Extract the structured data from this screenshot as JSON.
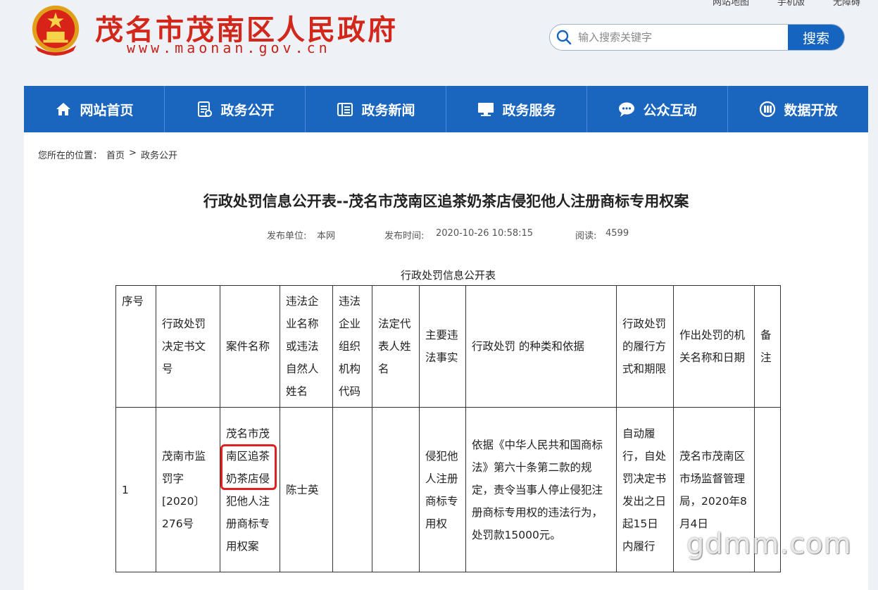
{
  "site": {
    "title": "茂名市茂南区人民政府",
    "domain": "www.maonan.gov.cn",
    "toplinks": [
      "网站地图",
      "手机版",
      "无障碍"
    ]
  },
  "search": {
    "placeholder": "输入搜索关键字",
    "button_label": "搜索"
  },
  "nav": {
    "items": [
      {
        "label": "网站首页",
        "icon": "home-icon"
      },
      {
        "label": "政务公开",
        "icon": "document-icon"
      },
      {
        "label": "政务新闻",
        "icon": "news-icon"
      },
      {
        "label": "政务服务",
        "icon": "monitor-icon"
      },
      {
        "label": "公众互动",
        "icon": "chat-icon"
      },
      {
        "label": "数据开放",
        "icon": "data-icon"
      }
    ]
  },
  "breadcrumb": {
    "prefix": "您所在的位置：",
    "items": [
      "首页",
      "政务公开"
    ],
    "separator": ">"
  },
  "article": {
    "title": "行政处罚信息公开表--茂名市茂南区追茶奶茶店侵犯他人注册商标专用权案",
    "publisher_label": "发布单位:",
    "publisher": "本网",
    "time_label": "发布时间:",
    "time": "2020-10-26 10:58:15",
    "views_label": "阅读:",
    "views": "4599"
  },
  "table": {
    "caption": "行政处罚信息公开表",
    "headers": [
      "序号",
      "行政处罚决定书文号",
      "案件名称",
      "违法企业名称或违法自然人姓名",
      "违法企业组织机构代码",
      "法定代表人姓名",
      "主要违法事实",
      "行政处罚 的种类和依据",
      "行政处罚的履行方式和期限",
      "作出处罚的机关名称和日期",
      "备注"
    ],
    "rows": [
      {
        "no": "1",
        "doc_no": "茂南市监罚字[2020〕276号",
        "case_name": "茂名市茂南区追茶奶茶店侵犯他人注册商标专用权案",
        "party": "陈士英",
        "org_code": "",
        "legal_rep": "",
        "facts": "侵犯他人注册 商标专用权",
        "basis": "依据《中华人民共和国商标法》第六十条第二款的规定，责令当事人停止侵犯注册商标专用权的违法行为，处罚款15000元。",
        "execution": "自动履行，自处罚决定书发出之日起15日内履行",
        "authority": "茂名市茂南区市场监督管理局，2020年8月4日",
        "remark": ""
      }
    ]
  },
  "watermark": "gdmm.com",
  "colors": {
    "brand_red": "#d2281c",
    "nav_blue": "#1a66bf",
    "highlight": "#e02020"
  }
}
